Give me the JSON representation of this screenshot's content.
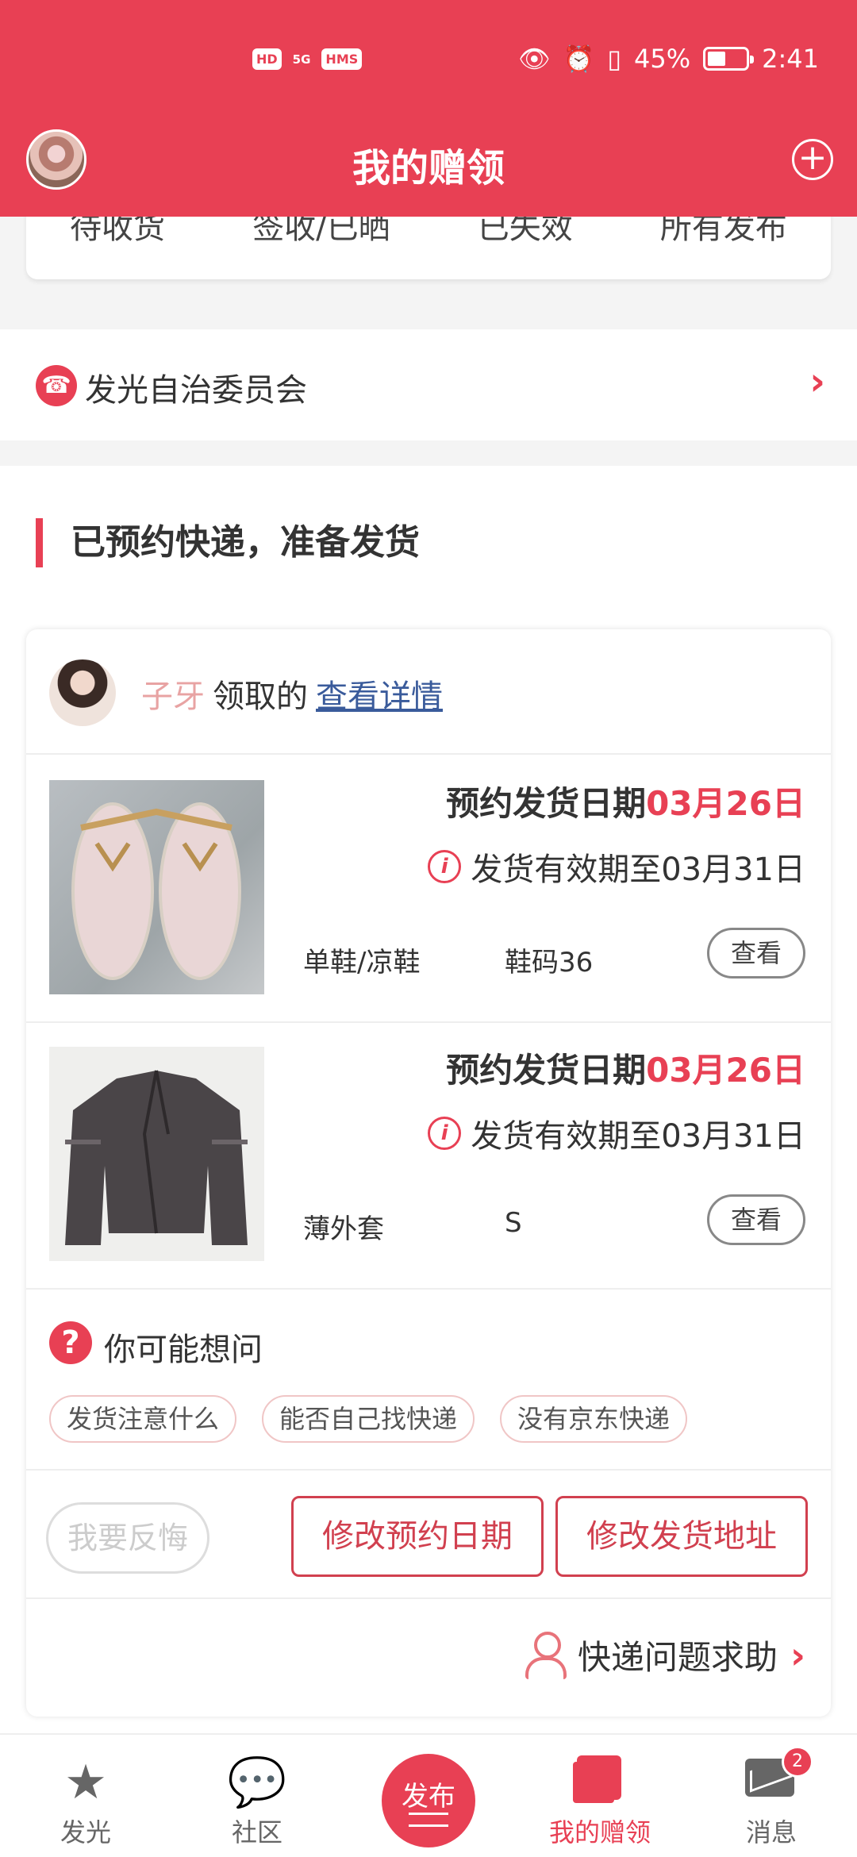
{
  "status_bar": {
    "battery": "45%",
    "time": "2:41",
    "network": "5G",
    "hd": "HD",
    "hms": "HMS"
  },
  "header": {
    "title": "我的赠领"
  },
  "tabs": [
    "待收货",
    "签收/已晒",
    "已失效",
    "所有发布"
  ],
  "committee": {
    "label": "发光自治委员会"
  },
  "section": {
    "title": "已预约快递，准备发货"
  },
  "receiver": {
    "name": "子牙",
    "action": "领取的",
    "link": "查看详情"
  },
  "items": [
    {
      "date_label": "预约发货日期",
      "date": "03月26日",
      "valid": "发货有效期至03月31日",
      "category": "单鞋/凉鞋",
      "size": "鞋码36",
      "view": "查看"
    },
    {
      "date_label": "预约发货日期",
      "date": "03月26日",
      "valid": "发货有效期至03月31日",
      "category": "薄外套",
      "size": "S",
      "view": "查看"
    }
  ],
  "faq": {
    "label": "你可能想问",
    "chips": [
      "发货注意什么",
      "能否自己找快递",
      "没有京东快递"
    ]
  },
  "actions": {
    "regret": "我要反悔",
    "change_date": "修改预约日期",
    "change_address": "修改发货地址"
  },
  "help": {
    "label": "快递问题求助"
  },
  "bottom_nav": {
    "items": [
      {
        "label": "发光",
        "icon": "star-icon"
      },
      {
        "label": "社区",
        "icon": "chat-icon"
      },
      {
        "label": "发布",
        "icon": "publish-icon"
      },
      {
        "label": "我的赠领",
        "icon": "gift-icon"
      },
      {
        "label": "消息",
        "icon": "mail-icon"
      }
    ],
    "badge": "2",
    "active": "我的赠领"
  },
  "colors": {
    "primary": "#e84054",
    "link": "#3a5b9b",
    "receiver_name": "#e8a3a3"
  }
}
